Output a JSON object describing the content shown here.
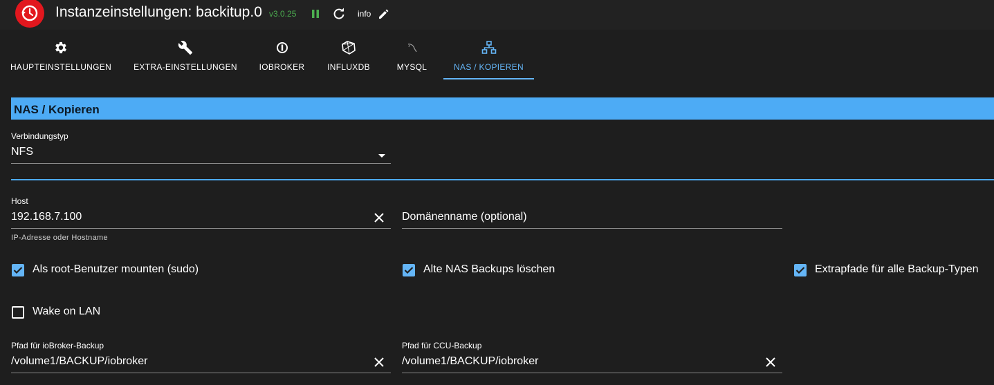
{
  "header": {
    "title": "Instanzeinstellungen: backitup.0",
    "version": "v3.0.25",
    "info_label": "info",
    "icons": [
      "backitup-logo-icon",
      "pause-icon",
      "refresh-icon",
      "edit-icon"
    ],
    "colors": {
      "logo": "#e2171e",
      "version": "#4caf50",
      "pause": "#4caf50"
    }
  },
  "tabs": [
    {
      "label": "HAUPTEINSTELLUNGEN",
      "icon": "gear-icon"
    },
    {
      "label": "EXTRA-EINSTELLUNGEN",
      "icon": "wrench-icon"
    },
    {
      "label": "IOBROKER",
      "icon": "iobroker-icon"
    },
    {
      "label": "INFLUXDB",
      "icon": "influxdb-icon"
    },
    {
      "label": "MYSQL",
      "icon": "mysql-icon"
    },
    {
      "label": "NAS / KOPIEREN",
      "icon": "network-icon",
      "active": true
    }
  ],
  "section": {
    "title": "NAS / Kopieren",
    "accent": "#4dabf5"
  },
  "connection_type": {
    "label": "Verbindungstyp",
    "value": "NFS"
  },
  "host": {
    "label": "Host",
    "value": "192.168.7.100",
    "helper": "IP-Adresse oder Hostname"
  },
  "domain": {
    "placeholder": "Domänenname (optional)"
  },
  "checkboxes": {
    "sudo": {
      "label": "Als root-Benutzer mounten (sudo)",
      "checked": true
    },
    "delete_old": {
      "label": "Alte NAS Backups löschen",
      "checked": true
    },
    "extra_paths": {
      "label": "Extrapfade für alle Backup-Typen",
      "checked": true
    },
    "wol": {
      "label": "Wake on LAN",
      "checked": false
    }
  },
  "iobroker_path": {
    "label": "Pfad für ioBroker-Backup",
    "value": "/volume1/BACKUP/iobroker"
  },
  "ccu_path": {
    "label": "Pfad für CCU-Backup",
    "value": "/volume1/BACKUP/iobroker"
  }
}
